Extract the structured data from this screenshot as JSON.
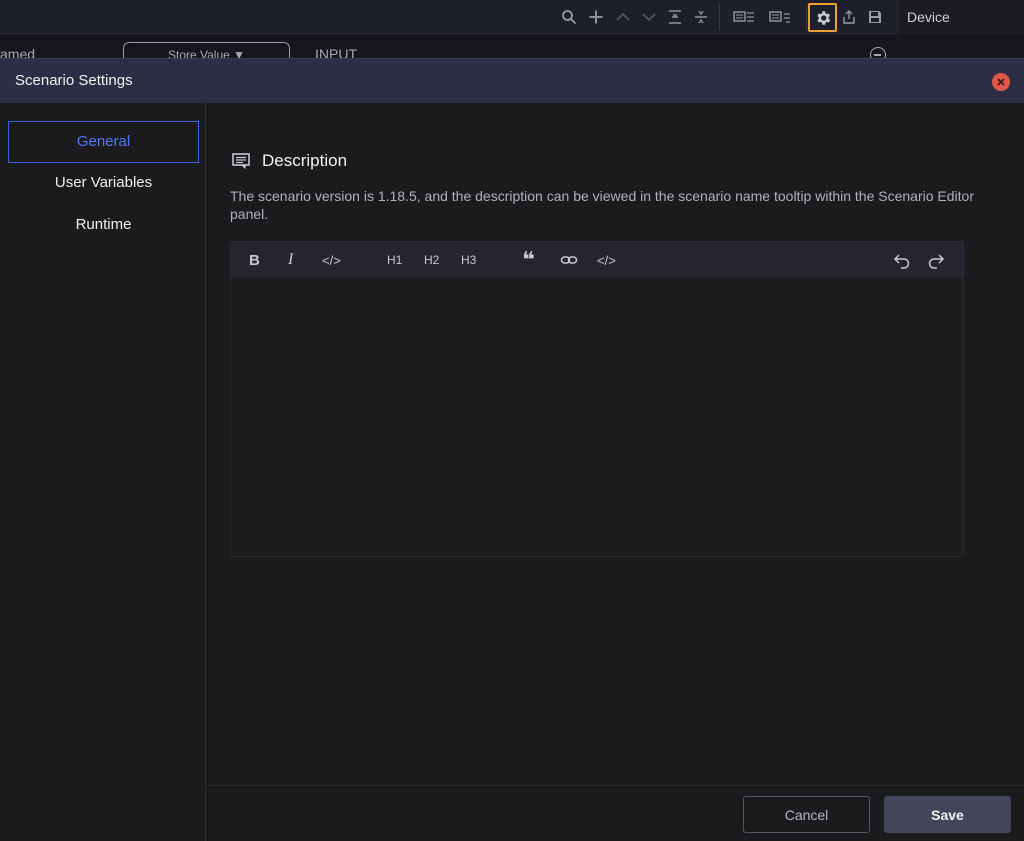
{
  "background": {
    "device_label": "Device",
    "row_named": "amed",
    "row_store_value": "Store Value ▼",
    "row_input": "INPUT"
  },
  "toolbar_icons": [
    "search-icon",
    "plus-icon",
    "chevron-up-icon",
    "chevron-down-icon",
    "align-center-icon",
    "split-icon",
    "panel-left-icon",
    "panel-right-icon",
    "gear-icon",
    "export-icon",
    "save-icon"
  ],
  "modal": {
    "title": "Scenario Settings",
    "nav": [
      {
        "label": "General",
        "active": true
      },
      {
        "label": "User Variables",
        "active": false
      },
      {
        "label": "Runtime",
        "active": false
      }
    ],
    "description": {
      "heading": "Description",
      "text": "The scenario version is 1.18.5, and the description can be viewed in the scenario name tooltip within the Scenario Editor panel."
    },
    "editor": {
      "toolbar": [
        "B",
        "I",
        "</>",
        "H1",
        "H2",
        "H3",
        "❝",
        "link",
        "</>",
        "undo",
        "redo"
      ],
      "content": ""
    },
    "footer": {
      "cancel_label": "Cancel",
      "save_label": "Save"
    }
  },
  "colors": {
    "accent": "#4f79f5",
    "highlight": "#f0a030",
    "close": "#e0584c",
    "header": "#2c2e45"
  }
}
